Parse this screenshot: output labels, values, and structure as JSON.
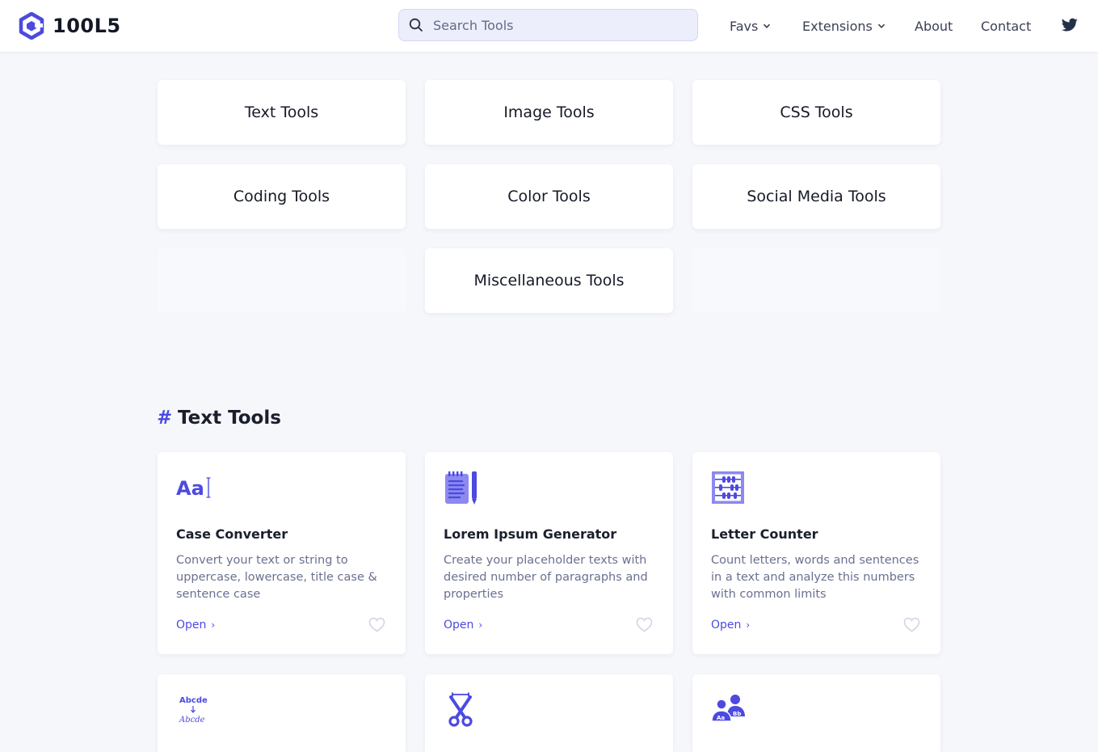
{
  "header": {
    "logo_text": "100L5",
    "search_placeholder": "Search Tools",
    "nav": [
      "Favs",
      "Extensions",
      "About",
      "Contact"
    ]
  },
  "categories": [
    "Text Tools",
    "Image Tools",
    "CSS Tools",
    "Coding Tools",
    "Color Tools",
    "Social Media Tools",
    "Miscellaneous Tools"
  ],
  "section": {
    "hash": "#",
    "title": "Text Tools"
  },
  "tools": [
    {
      "name": "Case Converter",
      "desc": "Convert your text or string to uppercase, lowercase, title case & sentence case",
      "open": "Open",
      "icon": "case-converter-icon",
      "icon_text": "Aa"
    },
    {
      "name": "Lorem Ipsum Generator",
      "desc": "Create your placeholder texts with desired number of paragraphs and properties",
      "open": "Open",
      "icon": "notepad-icon"
    },
    {
      "name": "Letter Counter",
      "desc": "Count letters, words and sentences in a text and analyze this numbers with common limits",
      "open": "Open",
      "icon": "abacus-icon"
    },
    {
      "icon": "text-transform-icon",
      "icon_text_top": "Abcde",
      "icon_text_bottom": "Abcde"
    },
    {
      "icon": "scissors-icon"
    },
    {
      "icon": "people-letters-icon",
      "icon_text_a": "Aa",
      "icon_text_b": "Bb"
    }
  ],
  "colors": {
    "accent": "#4c4ae0",
    "background": "#f5f7fb",
    "card": "#ffffff"
  }
}
